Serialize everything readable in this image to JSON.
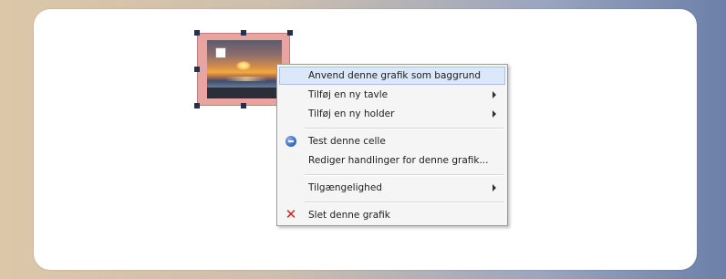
{
  "context_menu": {
    "items": [
      {
        "label": "Anvend denne grafik som baggrund"
      },
      {
        "label": "Tilføj en ny tavle"
      },
      {
        "label": "Tilføj en ny holder"
      },
      {
        "label": "Test denne celle"
      },
      {
        "label": "Rediger handlinger for denne grafik..."
      },
      {
        "label": "Tilgængelighed"
      },
      {
        "label": "Slet denne grafik"
      }
    ]
  },
  "icons": {
    "test": "test-cell-icon",
    "delete": "delete-x-icon",
    "delete_glyph": "✕",
    "submenu": "submenu-arrow-icon"
  },
  "colors": {
    "selection_fill": "#e8a4a0",
    "handle": "#23304f",
    "menu_highlight": "#dbe8f7",
    "delete_icon": "#d21f1f"
  }
}
